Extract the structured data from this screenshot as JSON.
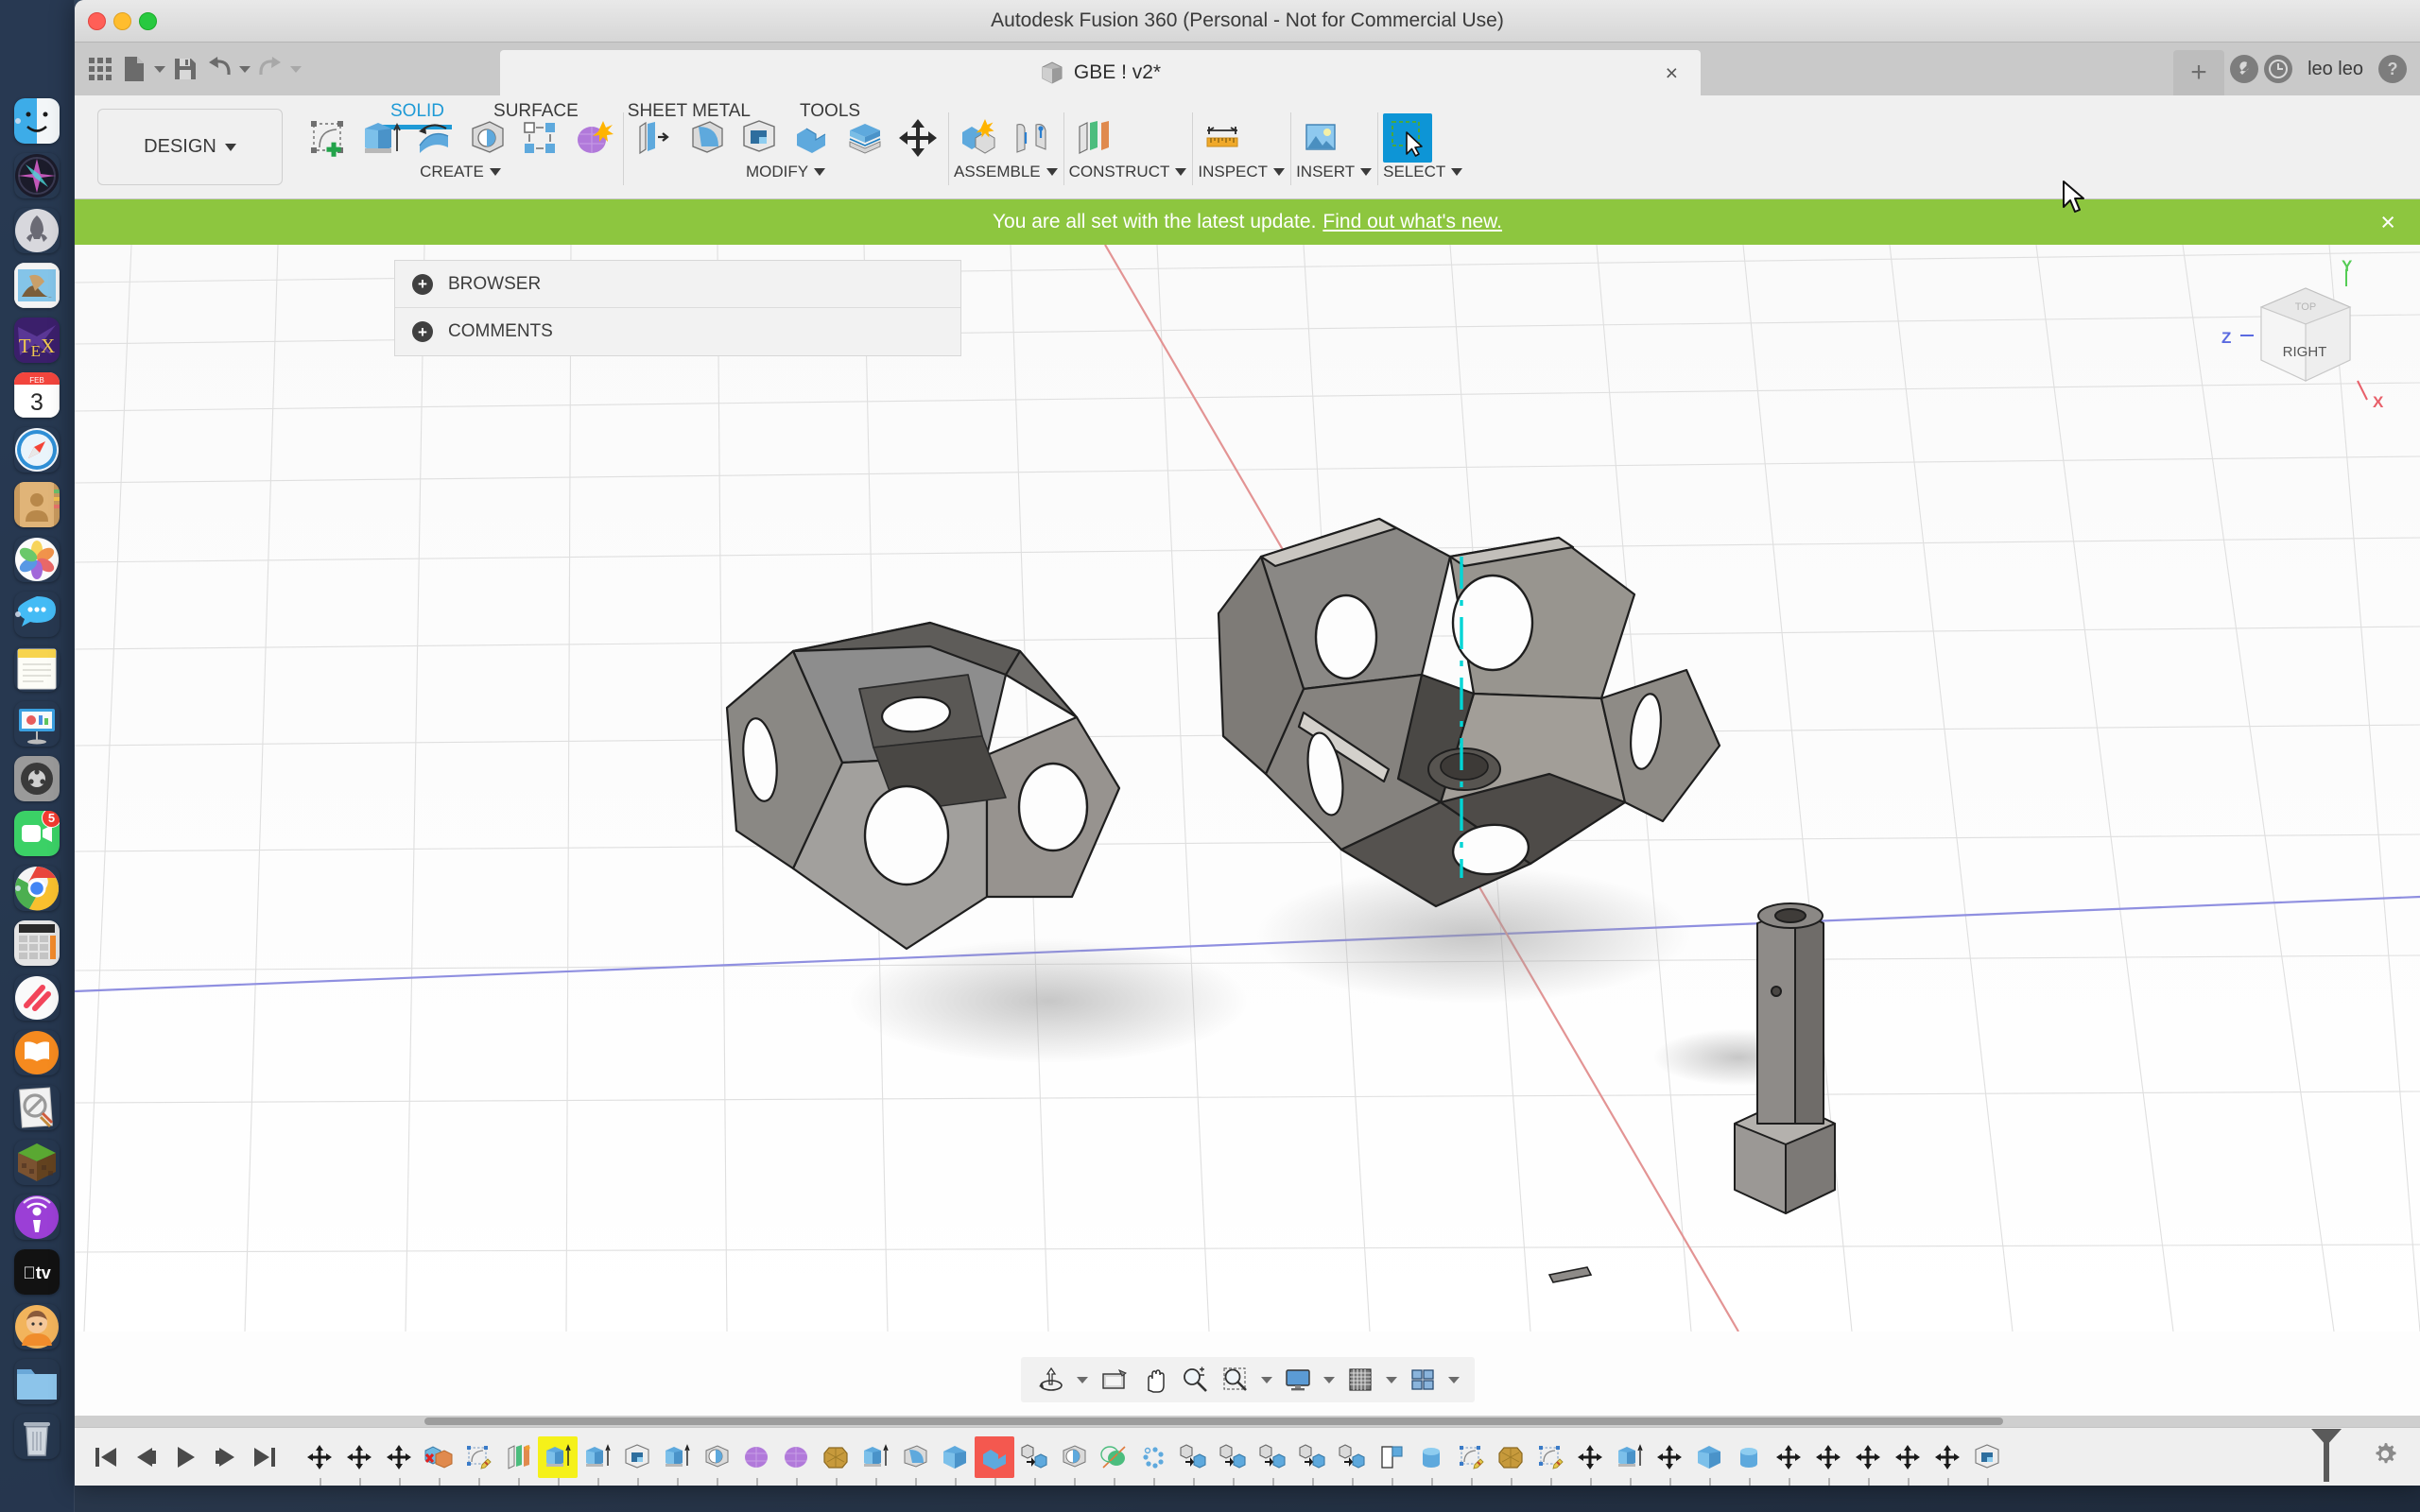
{
  "window": {
    "title": "Autodesk Fusion 360 (Personal - Not for Commercial Use)",
    "traffic_lights": [
      "close",
      "minimize",
      "zoom"
    ]
  },
  "quick_access": {
    "items": [
      {
        "name": "grid-apps-icon",
        "label": "Show Data Panel"
      },
      {
        "name": "file-icon",
        "label": "File"
      },
      {
        "name": "save-icon",
        "label": "Save"
      },
      {
        "name": "undo-icon",
        "label": "Undo"
      },
      {
        "name": "redo-icon",
        "label": "Redo"
      }
    ]
  },
  "document_tab": {
    "label": "GBE ! v2*",
    "close_label": "×",
    "new_tab_label": "+"
  },
  "header_right": {
    "user": "leo leo",
    "icons": [
      "wrench-icon",
      "clock-icon",
      "help-icon"
    ]
  },
  "ribbon": {
    "workspace": "DESIGN",
    "tabs": [
      {
        "label": "SOLID",
        "active": true
      },
      {
        "label": "SURFACE",
        "active": false
      },
      {
        "label": "SHEET METAL",
        "active": false
      },
      {
        "label": "TOOLS",
        "active": false
      }
    ],
    "panels": [
      {
        "label": "CREATE",
        "tools": [
          {
            "name": "create-sketch-icon",
            "label": "Create Sketch"
          },
          {
            "name": "extrude-icon",
            "label": "Extrude"
          },
          {
            "name": "revolve-icon",
            "label": "Revolve"
          },
          {
            "name": "sweep-icon",
            "label": "Sweep"
          },
          {
            "name": "pattern-icon",
            "label": "Pattern"
          },
          {
            "name": "create-form-icon",
            "label": "Create Form"
          }
        ]
      },
      {
        "label": "MODIFY",
        "tools": [
          {
            "name": "press-pull-icon",
            "label": "Press Pull"
          },
          {
            "name": "fillet-icon",
            "label": "Fillet"
          },
          {
            "name": "shell-icon",
            "label": "Shell"
          },
          {
            "name": "combine-icon",
            "label": "Combine"
          },
          {
            "name": "split-face-icon",
            "label": "Split Face"
          },
          {
            "name": "move-copy-icon",
            "label": "Move/Copy"
          }
        ]
      },
      {
        "label": "ASSEMBLE",
        "tools": [
          {
            "name": "new-component-icon",
            "label": "New Component"
          },
          {
            "name": "joint-icon",
            "label": "Joint"
          }
        ]
      },
      {
        "label": "CONSTRUCT",
        "tools": [
          {
            "name": "offset-plane-icon",
            "label": "Offset Plane"
          }
        ]
      },
      {
        "label": "INSPECT",
        "tools": [
          {
            "name": "measure-icon",
            "label": "Measure"
          }
        ]
      },
      {
        "label": "INSERT",
        "tools": [
          {
            "name": "insert-image-icon",
            "label": "Decal"
          }
        ]
      },
      {
        "label": "SELECT",
        "selected": true,
        "tools": [
          {
            "name": "select-cursor-icon",
            "label": "Select"
          }
        ]
      }
    ]
  },
  "banner": {
    "message": "You are all set with the latest update.",
    "link": "Find out what's new.",
    "close_label": "×",
    "color": "#8dc63f"
  },
  "side_panel": {
    "items": [
      {
        "label": "BROWSER",
        "expand": "+"
      },
      {
        "label": "COMMENTS",
        "expand": "+"
      }
    ]
  },
  "viewcube": {
    "face": "RIGHT",
    "axes": [
      {
        "label": "X",
        "color": "#e8606a"
      },
      {
        "label": "Y",
        "color": "#55cc55"
      },
      {
        "label": "Z",
        "color": "#5a6ae0"
      }
    ]
  },
  "canvas": {
    "model_description": "Two dodecahedral shell assemblies with circular face holes and a cylindrical pin component",
    "axis_colors": {
      "x": "#e88a8a",
      "y": "#8a8ae8",
      "z": "#00d8d8"
    },
    "grid_color": "#dcdcdc",
    "background": "#fdfdfd"
  },
  "navbar": {
    "items": [
      {
        "name": "orbit-icon",
        "label": "Orbit",
        "caret": true
      },
      {
        "name": "look-at-icon",
        "label": "Look At",
        "caret": false
      },
      {
        "name": "pan-icon",
        "label": "Pan",
        "caret": false
      },
      {
        "name": "zoom-icon",
        "label": "Zoom",
        "caret": false
      },
      {
        "name": "zoom-window-icon",
        "label": "Fit",
        "caret": true
      },
      {
        "name": "display-settings-icon",
        "label": "Display Settings",
        "caret": true
      },
      {
        "name": "grid-snaps-icon",
        "label": "Grid and Snaps",
        "caret": true
      },
      {
        "name": "viewports-icon",
        "label": "Viewports",
        "caret": true
      }
    ]
  },
  "timeline": {
    "playback": [
      {
        "name": "go-to-beginning-icon",
        "label": "Go to Beginning"
      },
      {
        "name": "step-back-icon",
        "label": "Step Back"
      },
      {
        "name": "play-icon",
        "label": "Play"
      },
      {
        "name": "step-forward-icon",
        "label": "Step Forward"
      },
      {
        "name": "go-to-end-icon",
        "label": "Go to End"
      }
    ],
    "features": [
      {
        "name": "move-feature",
        "type": "move",
        "state": "normal"
      },
      {
        "name": "move-feature",
        "type": "move",
        "state": "normal"
      },
      {
        "name": "move-feature",
        "type": "move",
        "state": "normal"
      },
      {
        "name": "remove-feature",
        "type": "remove",
        "state": "normal"
      },
      {
        "name": "sketch-feature",
        "type": "sketch",
        "state": "normal"
      },
      {
        "name": "plane-feature",
        "type": "plane",
        "state": "normal"
      },
      {
        "name": "extrude-feature",
        "type": "extrude",
        "state": "selected-yellow"
      },
      {
        "name": "extrude-feature",
        "type": "extrude",
        "state": "normal"
      },
      {
        "name": "shell-feature",
        "type": "shell",
        "state": "normal"
      },
      {
        "name": "extrude-feature",
        "type": "extrude",
        "state": "normal"
      },
      {
        "name": "revolve-feature",
        "type": "revolve",
        "state": "normal"
      },
      {
        "name": "form-feature",
        "type": "form",
        "state": "normal"
      },
      {
        "name": "form-feature",
        "type": "form",
        "state": "normal"
      },
      {
        "name": "appearance-feature",
        "type": "appearance",
        "state": "normal"
      },
      {
        "name": "extrude-feature",
        "type": "extrude",
        "state": "normal"
      },
      {
        "name": "fillet-feature",
        "type": "fillet",
        "state": "normal"
      },
      {
        "name": "box-feature",
        "type": "box",
        "state": "normal"
      },
      {
        "name": "combine-feature",
        "type": "combine",
        "state": "error-red"
      },
      {
        "name": "copy-paste-feature",
        "type": "copypaste",
        "state": "normal"
      },
      {
        "name": "revolve-feature",
        "type": "revolve",
        "state": "normal"
      },
      {
        "name": "mirror-feature",
        "type": "mirror",
        "state": "normal"
      },
      {
        "name": "pattern-feature",
        "type": "pattern",
        "state": "normal"
      },
      {
        "name": "copy-paste-feature",
        "type": "copypaste",
        "state": "normal"
      },
      {
        "name": "copy-paste-feature",
        "type": "copypaste",
        "state": "normal"
      },
      {
        "name": "copy-paste-feature",
        "type": "copypaste",
        "state": "normal"
      },
      {
        "name": "copy-paste-feature",
        "type": "copypaste",
        "state": "normal"
      },
      {
        "name": "copy-paste-feature",
        "type": "copypaste",
        "state": "normal"
      },
      {
        "name": "joint-feature",
        "type": "joint",
        "state": "normal"
      },
      {
        "name": "cylinder-feature",
        "type": "cylinder",
        "state": "normal"
      },
      {
        "name": "sketch-feature",
        "type": "sketch",
        "state": "normal"
      },
      {
        "name": "appearance-feature",
        "type": "appearance",
        "state": "normal"
      },
      {
        "name": "sketch-feature",
        "type": "sketch",
        "state": "normal"
      },
      {
        "name": "move-feature",
        "type": "move",
        "state": "normal"
      },
      {
        "name": "extrude-feature",
        "type": "extrude",
        "state": "normal"
      },
      {
        "name": "move-feature",
        "type": "move",
        "state": "normal"
      },
      {
        "name": "box-feature",
        "type": "box",
        "state": "normal"
      },
      {
        "name": "cylinder-feature",
        "type": "cylinder",
        "state": "normal"
      },
      {
        "name": "move-feature",
        "type": "move",
        "state": "normal"
      },
      {
        "name": "move-feature",
        "type": "move",
        "state": "normal"
      },
      {
        "name": "move-feature",
        "type": "move",
        "state": "normal"
      },
      {
        "name": "move-feature",
        "type": "move",
        "state": "normal"
      },
      {
        "name": "move-feature",
        "type": "move",
        "state": "normal"
      },
      {
        "name": "shell-feature",
        "type": "shell",
        "state": "normal"
      }
    ],
    "settings_icon": "gear-icon"
  },
  "dock": {
    "items": [
      {
        "name": "finder",
        "label": "Finder",
        "running": true
      },
      {
        "name": "siri",
        "label": "Siri",
        "running": false
      },
      {
        "name": "launchpad",
        "label": "Launchpad",
        "running": false
      },
      {
        "name": "mail",
        "label": "Mail",
        "running": false
      },
      {
        "name": "texshop",
        "label": "TeX",
        "running": false
      },
      {
        "name": "calendar",
        "label": "Calendar",
        "running": false,
        "month": "FEB",
        "day": "3"
      },
      {
        "name": "safari",
        "label": "Safari",
        "running": false
      },
      {
        "name": "contacts",
        "label": "Contacts",
        "running": false
      },
      {
        "name": "photos",
        "label": "Photos",
        "running": false
      },
      {
        "name": "messages",
        "label": "Messages",
        "running": true
      },
      {
        "name": "notes",
        "label": "Notes",
        "running": false
      },
      {
        "name": "keynote",
        "label": "Keynote",
        "running": false
      },
      {
        "name": "system-preferences",
        "label": "System Preferences",
        "running": false
      },
      {
        "name": "facetime",
        "label": "FaceTime",
        "running": false,
        "badge": "5"
      },
      {
        "name": "chrome",
        "label": "Google Chrome",
        "running": true
      },
      {
        "name": "calculator",
        "label": "Calculator",
        "running": false
      },
      {
        "name": "news",
        "label": "News",
        "running": false
      },
      {
        "name": "books",
        "label": "Books",
        "running": false
      },
      {
        "name": "preview",
        "label": "Preview",
        "running": false
      },
      {
        "name": "minecraft",
        "label": "Minecraft",
        "running": false
      },
      {
        "name": "podcasts",
        "label": "Podcasts",
        "running": false
      },
      {
        "name": "appletv",
        "label": "Apple TV",
        "running": false
      },
      {
        "name": "memoji",
        "label": "Memoji",
        "running": false
      },
      {
        "name": "folder",
        "label": "Downloads",
        "running": false
      },
      {
        "name": "trash",
        "label": "Trash",
        "running": false
      }
    ]
  }
}
